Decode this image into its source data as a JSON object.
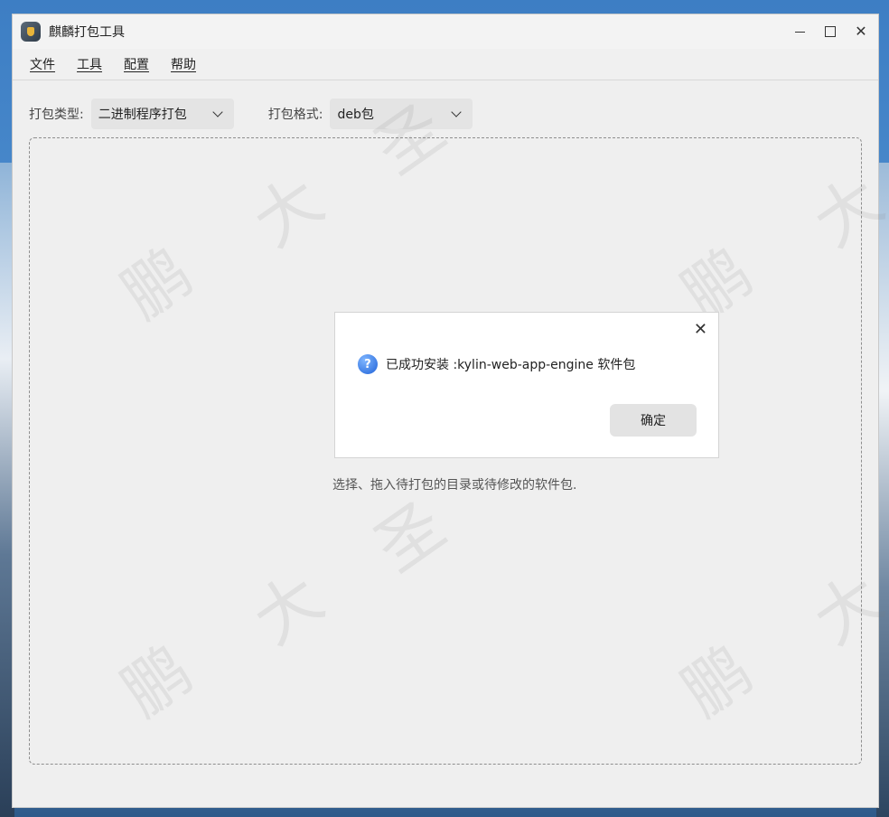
{
  "window": {
    "title": "麒麟打包工具"
  },
  "menu": {
    "items": [
      "文件",
      "工具",
      "配置",
      "帮助"
    ]
  },
  "toolbar": {
    "type_label": "打包类型:",
    "type_value": "二进制程序打包",
    "format_label": "打包格式:",
    "format_value": "deb包"
  },
  "dropzone": {
    "hint": "选择、拖入待打包的目录或待修改的软件包."
  },
  "dialog": {
    "icon": "question-icon",
    "message": "已成功安装 :kylin-web-app-engine 软件包",
    "ok_label": "确定"
  },
  "watermark": {
    "chars": [
      "鹏",
      "大",
      "圣"
    ]
  },
  "colors": {
    "window_bg": "#efefef",
    "dialog_bg": "#ffffff",
    "button_bg": "#e3e3e3",
    "accent": "#1f62d8"
  }
}
